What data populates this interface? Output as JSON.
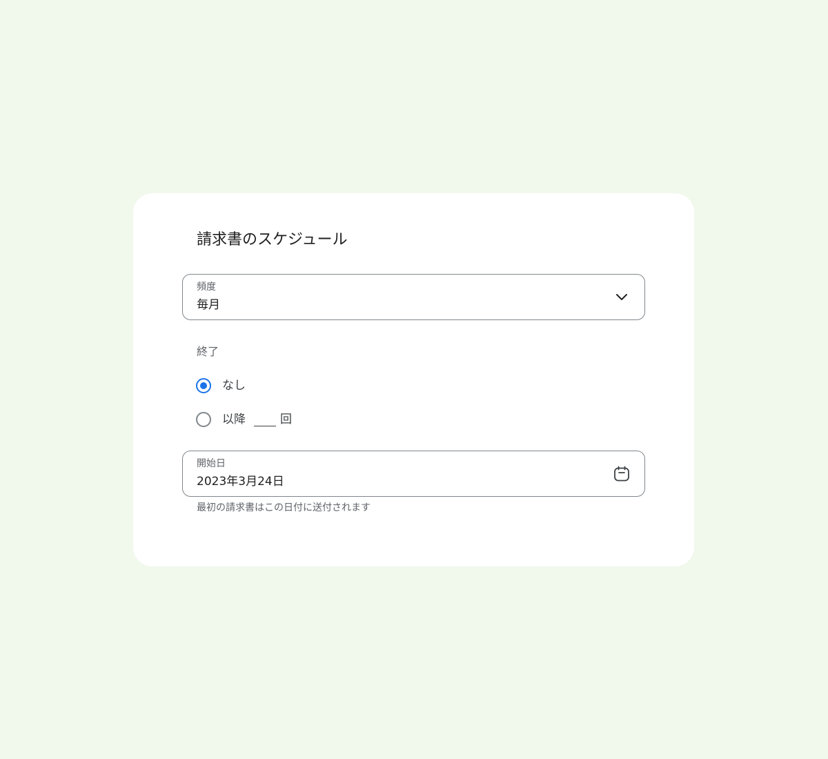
{
  "dialog": {
    "title": "請求書のスケジュール"
  },
  "frequency": {
    "label": "頻度",
    "value": "毎月",
    "icon": "chevron-down-icon"
  },
  "end": {
    "label": "終了",
    "options": [
      {
        "label": "なし",
        "selected": true
      },
      {
        "label": "以降",
        "suffix": "回",
        "selected": false
      }
    ]
  },
  "start_date": {
    "label": "開始日",
    "value": "2023年3月24日",
    "icon": "calendar-icon",
    "helper": "最初の請求書はこの日付に送付されます"
  },
  "colors": {
    "background": "#f1f8ec",
    "card": "#ffffff",
    "accent": "#1a73e8",
    "outline": "#80868b"
  }
}
